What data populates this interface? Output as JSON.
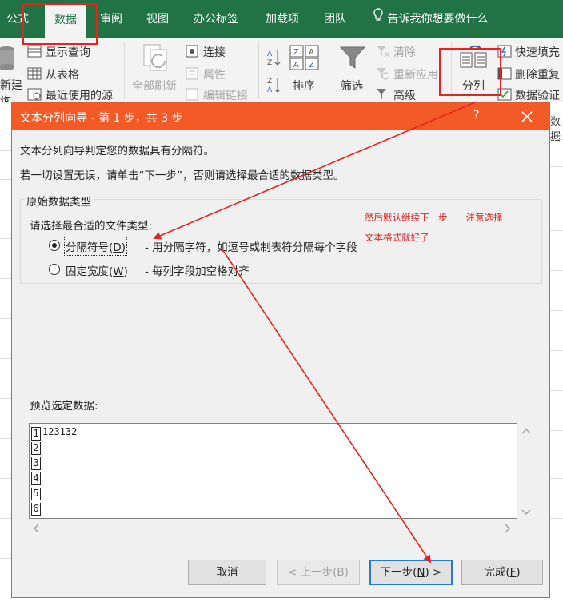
{
  "ribbon": {
    "tabs": [
      {
        "label": "公式"
      },
      {
        "label": "数据"
      },
      {
        "label": "审阅"
      },
      {
        "label": "视图"
      },
      {
        "label": "办公标签"
      },
      {
        "label": "加载项"
      },
      {
        "label": "团队"
      }
    ],
    "tell_me": "告诉我你想要做什么",
    "get_data": {
      "new_query_partial": "新建",
      "new_query_partial2": "询",
      "show_queries": "显示查询",
      "from_table": "从表格",
      "recent_sources": "最近使用的源"
    },
    "connections": {
      "refresh_all": "全部刷新",
      "connections": "连接",
      "properties": "属性",
      "edit_links": "编辑链接"
    },
    "sort_filter": {
      "sort": "排序",
      "filter": "筛选",
      "clear": "清除",
      "reapply": "重新应用",
      "advanced": "高级"
    },
    "data_tools": {
      "text_to_columns": "分列",
      "flash_fill": "快速填充",
      "remove_duplicates": "删除重复",
      "data_validation": "数据验证",
      "partial_right": "数据"
    },
    "sort_icons": {
      "az": "A↓Z",
      "za": "Z↓A"
    }
  },
  "dialog": {
    "title": "文本分列向导 - 第 1 步，共 3 步",
    "help": "?",
    "line1": "文本分列向导判定您的数据具有分隔符。",
    "line2": "若一切设置无误，请单击“下一步”，否则请选择最合适的数据类型。",
    "group_title": "原始数据类型",
    "group_prompt": "请选择最合适的文件类型:",
    "options": [
      {
        "label": "分隔符号(",
        "key": "D",
        "close": ")",
        "desc": "- 用分隔字符，如逗号或制表符分隔每个字段",
        "selected": true
      },
      {
        "label": "固定宽度(",
        "key": "W",
        "close": ")",
        "desc": "- 每列字段加空格对齐",
        "selected": false
      }
    ],
    "preview_label": "预览选定数据:",
    "preview_rows": [
      "1",
      "2",
      "3",
      "4",
      "5",
      "6"
    ],
    "preview_text": "123132",
    "buttons": {
      "cancel": "取消",
      "back": "< 上一步(B)",
      "next_pre": "下一步(",
      "next_key": "N",
      "next_post": ") >",
      "finish_pre": "完成(",
      "finish_key": "F",
      "finish_post": ")"
    }
  },
  "annotations": {
    "note_line1": "然后默认继续下一步一一注意选择",
    "note_line2": "文本格式就好了"
  }
}
